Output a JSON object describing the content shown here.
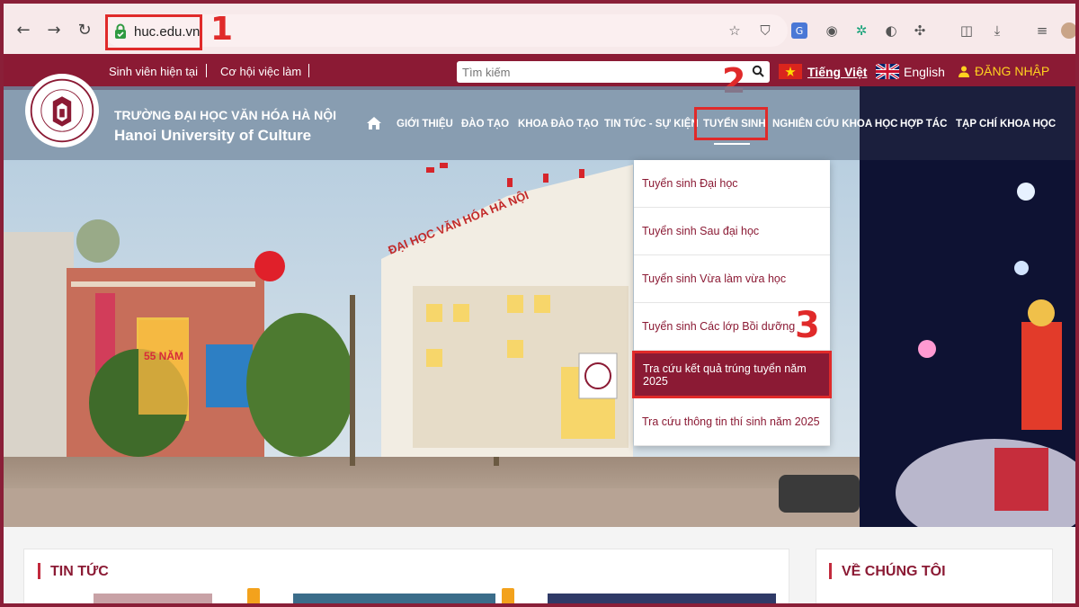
{
  "browser": {
    "url": "huc.edu.vn"
  },
  "annotations": {
    "step1": "1",
    "step2": "2",
    "step3": "3"
  },
  "topbar": {
    "link1": "Sinh viên hiện tại",
    "link2": "Cơ hội việc làm",
    "search_placeholder": "Tìm kiếm",
    "lang_vn": "Tiếng Việt",
    "lang_en": "English",
    "login": "ĐĂNG NHẬP"
  },
  "header": {
    "school_vn": "TRƯỜNG ĐẠI HỌC VĂN HÓA HÀ NỘI",
    "school_en": "Hanoi University of Culture",
    "menu": [
      "GIỚI THIỆU",
      "ĐÀO TẠO",
      "KHOA ĐÀO TẠO",
      "TIN TỨC - SỰ KIỆN",
      "TUYỂN SINH",
      "NGHIÊN CỨU KHOA HỌC",
      "HỢP TÁC",
      "TẠP CHÍ KHOA HỌC"
    ]
  },
  "dropdown": {
    "items": [
      "Tuyển sinh Đại học",
      "Tuyển sinh Sau đại học",
      "Tuyển sinh Vừa làm vừa học",
      "Tuyển sinh Các lớp Bồi dưỡng",
      "Tra cứu kết quả trúng tuyển năm 2025",
      "Tra cứu thông tin thí sinh năm 2025"
    ],
    "active_index": 4
  },
  "sections": {
    "news": "TIN TỨC",
    "about": "VỀ CHÚNG TÔI"
  },
  "hero": {
    "banner_text": "55 NĂM",
    "building_sign": "ĐẠI HỌC VĂN HÓA HÀ NỘI"
  },
  "colors": {
    "brand": "#8b1a34",
    "highlight": "#e02a2a",
    "login": "#ffd21f"
  }
}
